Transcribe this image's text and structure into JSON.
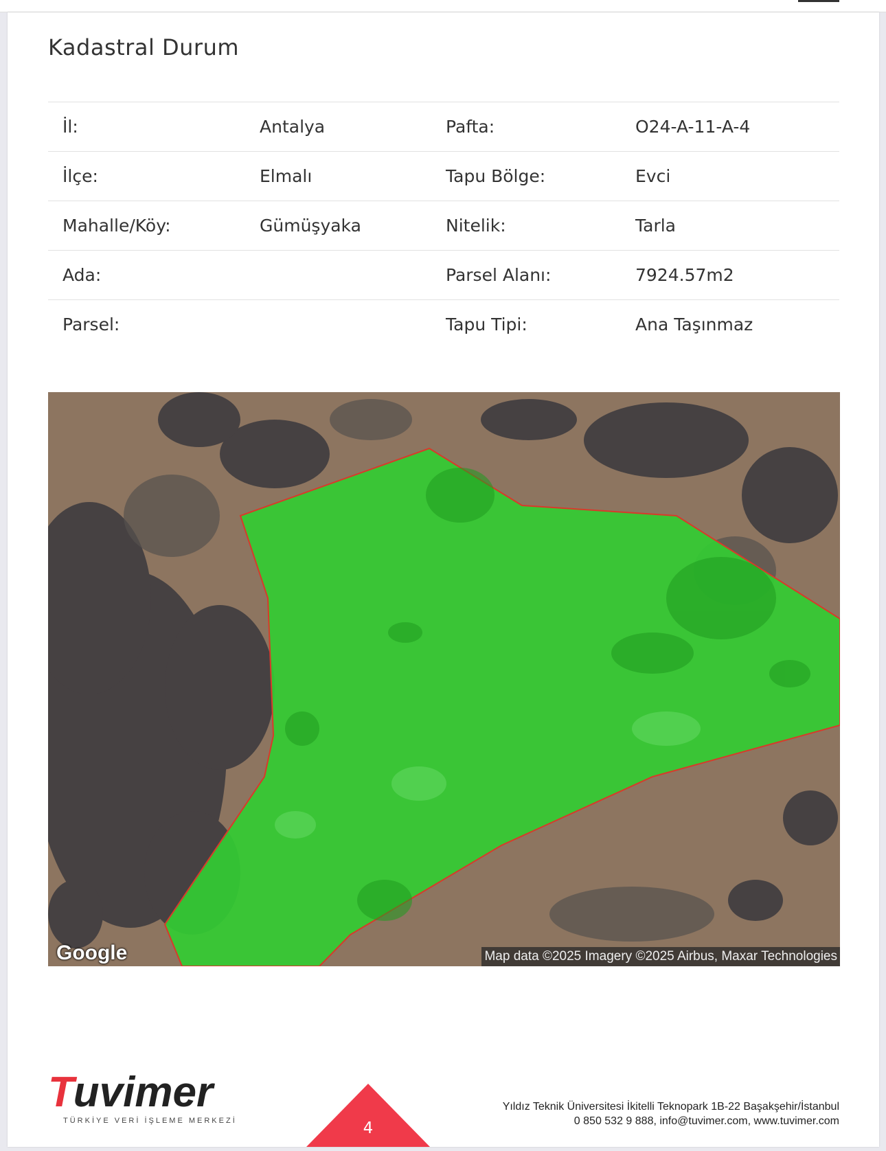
{
  "section": {
    "title": "Kadastral Durum"
  },
  "rows": [
    {
      "label1": "İl:",
      "value1": "Antalya",
      "label2": "Pafta:",
      "value2": "O24-A-11-A-4"
    },
    {
      "label1": "İlçe:",
      "value1": "Elmalı",
      "label2": "Tapu Bölge:",
      "value2": "Evci"
    },
    {
      "label1": "Mahalle/Köy:",
      "value1": "Gümüşyaka",
      "label2": "Nitelik:",
      "value2": "Tarla"
    },
    {
      "label1": "Ada:",
      "value1": "",
      "label2": "Parsel Alanı:",
      "value2": "7924.57m2"
    },
    {
      "label1": "Parsel:",
      "value1": "",
      "label2": "Tapu Tipi:",
      "value2": "Ana Taşınmaz"
    }
  ],
  "map": {
    "provider_logo": "Google",
    "attribution": "Map data ©2025 Imagery ©2025 Airbus, Maxar Technologies",
    "parcel_fill_color": "#33cc33",
    "parcel_border_color": "#d83a2a"
  },
  "footer": {
    "logo_t": "T",
    "logo_rest": "uvimer",
    "logo_subtitle": "TÜRKİYE VERİ İŞLEME MERKEZİ",
    "page_number": "4",
    "address_line1": "Yıldız Teknik Üniversitesi İkitelli Teknopark 1B-22 Başakşehir/İstanbul",
    "address_line2": "0 850 532 9 888, info@tuvimer.com, www.tuvimer.com",
    "accent_color": "#f03a4a"
  }
}
